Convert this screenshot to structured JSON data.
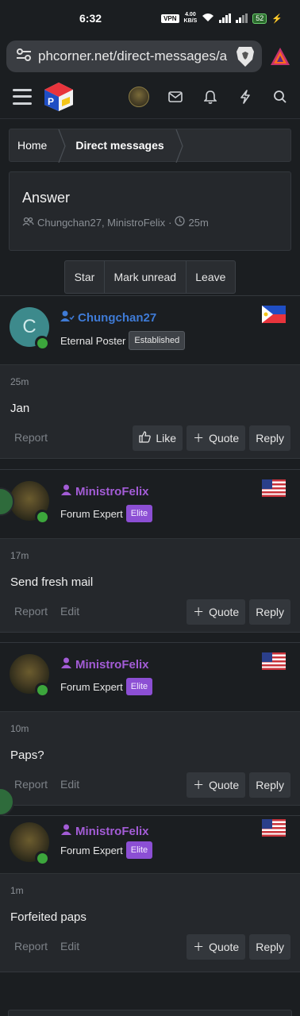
{
  "status_bar": {
    "time": "6:32",
    "vpn": "VPN",
    "speed_value": "4.00",
    "speed_unit": "KB/S",
    "battery": "52"
  },
  "browser": {
    "url": "phcorner.net/direct-messages/a"
  },
  "breadcrumb": {
    "home": "Home",
    "current": "Direct messages"
  },
  "conversation": {
    "title": "Answer",
    "participants": "Chungchan27, MinistroFelix",
    "separator": "·",
    "age": "25m"
  },
  "actions": {
    "star": "Star",
    "mark_unread": "Mark unread",
    "leave": "Leave"
  },
  "messages": [
    {
      "username": "Chungchan27",
      "avatar_letter": "C",
      "user_title": "Eternal Poster",
      "badge": "Established",
      "time": "25m",
      "text": "Jan",
      "report": "Report",
      "like": "Like",
      "quote": "Quote",
      "reply": "Reply",
      "flag": "philippines-flag"
    },
    {
      "username": "MinistroFelix",
      "user_title": "Forum Expert",
      "badge": "Elite",
      "time": "17m",
      "text": "Send fresh mail",
      "report": "Report",
      "edit": "Edit",
      "quote": "Quote",
      "reply": "Reply",
      "flag": "us-flag"
    },
    {
      "username": "MinistroFelix",
      "user_title": "Forum Expert",
      "badge": "Elite",
      "time": "10m",
      "text": "Paps?",
      "report": "Report",
      "edit": "Edit",
      "quote": "Quote",
      "reply": "Reply",
      "flag": "us-flag"
    },
    {
      "username": "MinistroFelix",
      "user_title": "Forum Expert",
      "badge": "Elite",
      "time": "1m",
      "text": "Forfeited paps",
      "report": "Report",
      "edit": "Edit",
      "quote": "Quote",
      "reply": "Reply",
      "flag": "us-flag"
    }
  ],
  "colors": {
    "background": "#1b1e21",
    "panel": "#25282c",
    "blue_user": "#3f7bd6",
    "purple_user": "#a35cd6",
    "elite_badge": "#8c4fd4",
    "online": "#3ca63c"
  }
}
